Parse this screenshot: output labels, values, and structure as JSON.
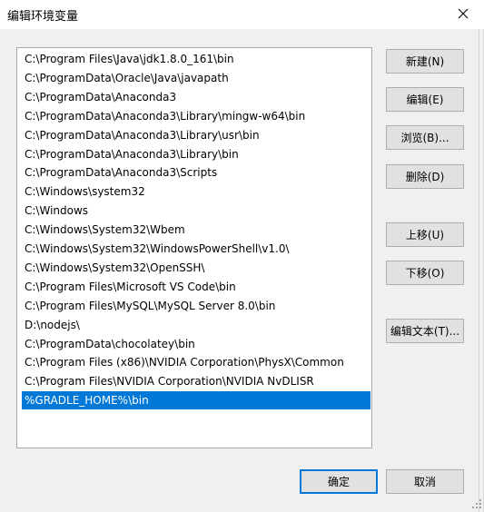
{
  "window": {
    "title": "编辑环境变量"
  },
  "path_list": {
    "items": [
      "C:\\Program Files\\Java\\jdk1.8.0_161\\bin",
      "C:\\ProgramData\\Oracle\\Java\\javapath",
      "C:\\ProgramData\\Anaconda3",
      "C:\\ProgramData\\Anaconda3\\Library\\mingw-w64\\bin",
      "C:\\ProgramData\\Anaconda3\\Library\\usr\\bin",
      "C:\\ProgramData\\Anaconda3\\Library\\bin",
      "C:\\ProgramData\\Anaconda3\\Scripts",
      "C:\\Windows\\system32",
      "C:\\Windows",
      "C:\\Windows\\System32\\Wbem",
      "C:\\Windows\\System32\\WindowsPowerShell\\v1.0\\",
      "C:\\Windows\\System32\\OpenSSH\\",
      "C:\\Program Files\\Microsoft VS Code\\bin",
      "C:\\Program Files\\MySQL\\MySQL Server 8.0\\bin",
      "D:\\nodejs\\",
      "C:\\ProgramData\\chocolatey\\bin",
      "C:\\Program Files (x86)\\NVIDIA Corporation\\PhysX\\Common",
      "C:\\Program Files\\NVIDIA Corporation\\NVIDIA NvDLISR",
      "%GRADLE_HOME%\\bin"
    ],
    "selected_index": 18
  },
  "buttons": {
    "new": "新建(N)",
    "edit": "编辑(E)",
    "browse": "浏览(B)...",
    "delete": "删除(D)",
    "move_up": "上移(U)",
    "move_down": "下移(O)",
    "edit_text": "编辑文本(T)...",
    "ok": "确定",
    "cancel": "取消"
  },
  "colors": {
    "selection": "#0078d7",
    "window_bg": "#f0f0f0",
    "default_button_border": "#0078d7"
  }
}
